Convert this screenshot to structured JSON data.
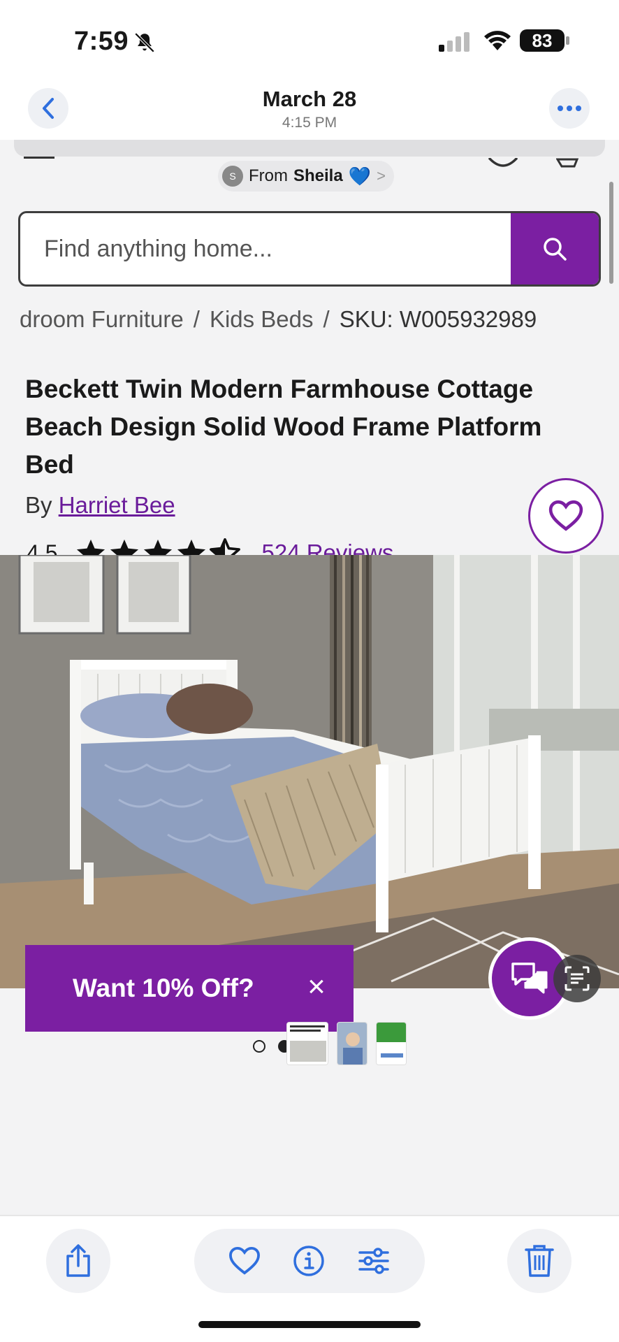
{
  "status_bar": {
    "time": "7:59",
    "battery": "83"
  },
  "photo_header": {
    "date": "March 28",
    "time": "4:15 PM"
  },
  "site": {
    "from_pill": {
      "avatar_initial": "S",
      "from_label": "From",
      "name": "Sheila",
      "emoji": "💙",
      "chevron": ">"
    },
    "search": {
      "placeholder": "Find anything home..."
    },
    "breadcrumb": {
      "items": [
        "droom Furniture",
        "Kids Beds",
        "SKU: W005932989"
      ],
      "separator": "/"
    },
    "product": {
      "title": "Beckett Twin Modern Farmhouse Cottage Beach Design Solid Wood Frame Platform Bed",
      "by_label": "By",
      "brand": "Harriet Bee",
      "rating": "4.5",
      "rating_value": 4.5,
      "reviews": "524 Reviews"
    },
    "promo": {
      "text": "Want 10% Off?",
      "close": "×"
    },
    "carousel": {
      "dot_count": 4,
      "active_index": 1
    }
  },
  "colors": {
    "brand_purple": "#7b1fa2",
    "link_purple": "#6a1b9a",
    "ios_blue": "#2f6fde"
  },
  "toolbar": {
    "icons": [
      "share-icon",
      "heart-icon",
      "info-icon",
      "adjust-icon",
      "trash-icon"
    ]
  }
}
